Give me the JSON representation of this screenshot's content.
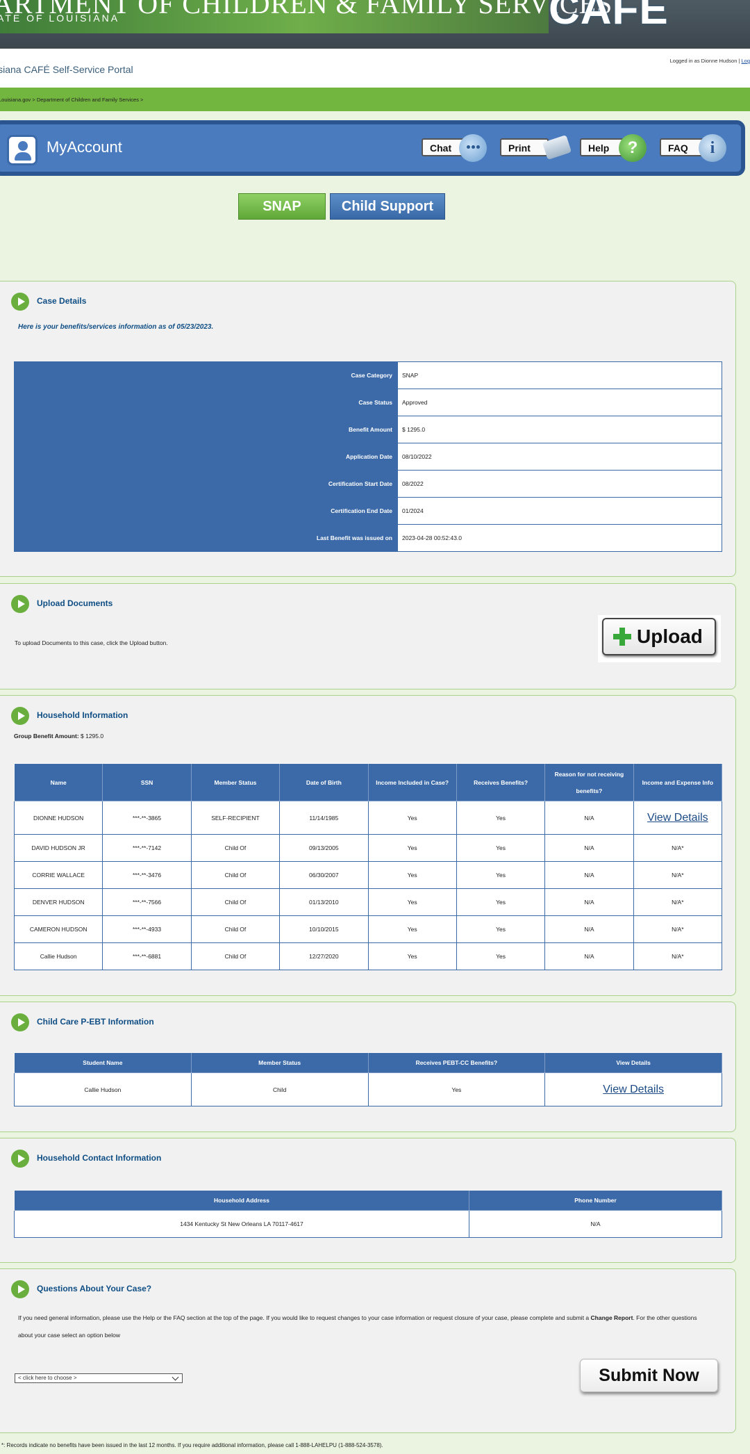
{
  "header": {
    "banner_title": "ARTMENT OF CHILDREN & FAMILY SERVICES",
    "banner_subtitle": "ATE OF LOUISIANA",
    "logo_text": "CAFE",
    "portal_title": "isiana CAFÉ Self-Service Portal",
    "logged_in_text": "Logged in as Dionne Hudson | ",
    "logout_link": "Log",
    "breadcrumb": "Louisiana.gov >  Department of Children and Family Services >"
  },
  "account_bar": {
    "title": "MyAccount",
    "buttons": {
      "chat": "Chat",
      "print": "Print",
      "help": "Help",
      "faq": "FAQ"
    },
    "help_glyph": "?",
    "faq_glyph": "i"
  },
  "program_tabs": {
    "snap": "SNAP",
    "child_support": "Child Support"
  },
  "case_details": {
    "title": "Case Details",
    "intro": "Here is your benefits/services information as of 05/23/2023.",
    "rows": [
      {
        "label": "Case Category",
        "value": "SNAP"
      },
      {
        "label": "Case Status",
        "value": "Approved"
      },
      {
        "label": "Benefit Amount",
        "value": "$ 1295.0"
      },
      {
        "label": "Application Date",
        "value": "08/10/2022"
      },
      {
        "label": "Certification Start Date",
        "value": "08/2022"
      },
      {
        "label": "Certification End Date",
        "value": "01/2024"
      },
      {
        "label": "Last Benefit was issued on",
        "value": "2023-04-28 00:52:43.0"
      }
    ]
  },
  "upload_documents": {
    "title": "Upload Documents",
    "text": "To upload Documents to this case, click the Upload button.",
    "button": "Upload"
  },
  "household": {
    "title": "Household Information",
    "group_label": "Group Benefit Amount:",
    "group_value": " $ 1295.0",
    "columns": [
      "Name",
      "SSN",
      "Member Status",
      "Date of Birth",
      "Income Included in Case?",
      "Receives Benefits?",
      "Reason for not receiving benefits?",
      "Income and Expense Info"
    ],
    "rows": [
      [
        "DIONNE HUDSON",
        "***-**-3865",
        "SELF-RECIPIENT",
        "11/14/1985",
        "Yes",
        "Yes",
        "N/A",
        "View Details"
      ],
      [
        "DAVID HUDSON JR",
        "***-**-7142",
        "Child Of",
        "09/13/2005",
        "Yes",
        "Yes",
        "N/A",
        "N/A*"
      ],
      [
        "CORRIE WALLACE",
        "***-**-3476",
        "Child Of",
        "06/30/2007",
        "Yes",
        "Yes",
        "N/A",
        "N/A*"
      ],
      [
        "DENVER HUDSON",
        "***-**-7566",
        "Child Of",
        "01/13/2010",
        "Yes",
        "Yes",
        "N/A",
        "N/A*"
      ],
      [
        "CAMERON HUDSON",
        "***-**-4933",
        "Child Of",
        "10/10/2015",
        "Yes",
        "Yes",
        "N/A",
        "N/A*"
      ],
      [
        "Callie Hudson",
        "***-**-6881",
        "Child Of",
        "12/27/2020",
        "Yes",
        "Yes",
        "N/A",
        "N/A*"
      ]
    ]
  },
  "pebt": {
    "title": "Child Care P-EBT Information",
    "columns": [
      "Student Name",
      "Member Status",
      "Receives PEBT-CC Benefits?",
      "View Details"
    ],
    "rows": [
      [
        "Callie Hudson",
        "Child",
        "Yes",
        "View Details"
      ]
    ]
  },
  "contact": {
    "title": "Household Contact Information",
    "columns": [
      "Household Address",
      "Phone Number"
    ],
    "rows": [
      [
        "1434 Kentucky St New Orleans LA 70117-4617",
        "N/A"
      ]
    ]
  },
  "questions": {
    "title": "Questions About Your Case?",
    "text_1": "If you need general information, please use the Help or the FAQ section at the top of the page. If you would like to request changes to your case information or request closure of your case, please complete and submit a ",
    "text_bold": "Change Report",
    "text_2": ". For the other questions about your case select an option below",
    "select_value": "< click here to choose >",
    "submit": "Submit Now"
  },
  "footnote": "*: Records indicate no benefits have been issued in the last 12 months. If you require additional information, please call 1-888-LAHELPU (1-888-524-3578).",
  "colors": {
    "header_blue": "#3c6aa8",
    "accent_green": "#72b53f",
    "title_blue": "#0f4e85"
  }
}
